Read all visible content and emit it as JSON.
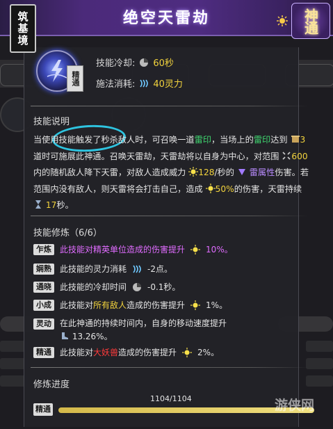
{
  "title": "绝空天雷劫",
  "realm": "筑基境",
  "rank_badge": "神通",
  "skill_tag": "精通",
  "stats": {
    "cooldown_label": "技能冷却:",
    "cooldown_value": "60秒",
    "cost_label": "施法消耗:",
    "cost_value": "40灵力"
  },
  "description": {
    "title": "技能说明",
    "p1": "当使用技能触发了秒杀敌人时，可召唤一道",
    "p1_hl": "雷印",
    "p2": "，当场上的",
    "p2_hl": "雷印",
    "p3": "达到",
    "p4_num": "3",
    "p5": "道时可施展此神通。召唤天雷劫，天雷劫将以自身为中心，对范围",
    "p6_num": "600",
    "p7": "内的随机敌人降下天雷，对敌人造成威力",
    "p8_num": "128",
    "p9": "/秒的",
    "p10_hl": "雷属性",
    "p11": "伤害。若范围内没有敌人，则天雷将会打击自己，造成",
    "p12_num": "50%",
    "p13": "的伤害，天雷持续",
    "p14_num": "17",
    "p15": "秒。"
  },
  "mods_title": "技能修炼（6/6）",
  "mods": [
    {
      "badge": "乍炼",
      "text_a": "此技能对",
      "text_hl": "精英单位",
      "text_b": "造成的伤害提升",
      "value": "10%。"
    },
    {
      "badge": "娴熟",
      "text_a": "此技能的灵力消耗",
      "value": "-2点。"
    },
    {
      "badge": "通晓",
      "text_a": "此技能的冷却时间",
      "value": "-0.1秒。"
    },
    {
      "badge": "小成",
      "text_a": "此技能对",
      "text_hl": "所有敌人",
      "text_b": "造成的伤害提升",
      "value": "1%。"
    },
    {
      "badge": "灵动",
      "text_a": "在此神通的持续时间内，自身的移动速度提升",
      "value": "13.26%。"
    },
    {
      "badge": "精通",
      "text_a": "此技能对",
      "text_hl": "大妖兽",
      "text_b": "造成的伤害提升",
      "value": "2%。"
    }
  ],
  "progress": {
    "title": "修炼进度",
    "label": "1104/1104",
    "tag": "精通",
    "fraction": 1.0
  },
  "watermark": "游侠网",
  "colors": {
    "title_bar": "#4e2c80",
    "highlight_green": "#3fd66f",
    "highlight_yellow": "#f2d33d",
    "highlight_pink": "#e06cff",
    "highlight_red": "#ff3b3b",
    "annotation_circle": "#2ec4e0"
  }
}
